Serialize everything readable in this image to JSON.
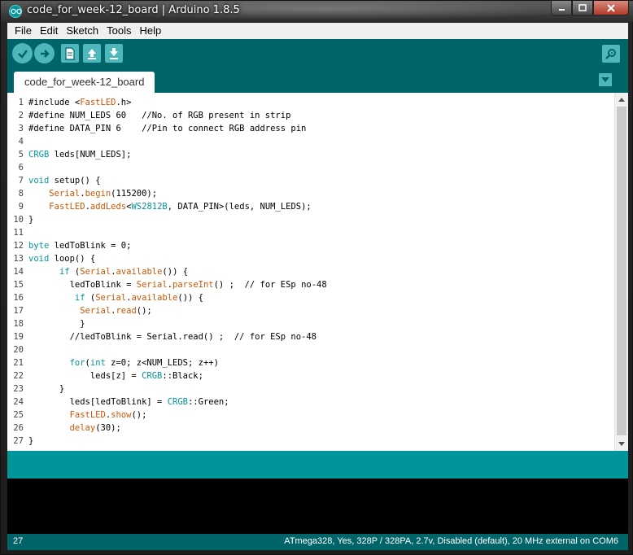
{
  "window": {
    "title": "code_for_week-12_board | Arduino 1.8.5"
  },
  "menu": [
    "File",
    "Edit",
    "Sketch",
    "Tools",
    "Help"
  ],
  "toolbar": {
    "buttons": [
      "verify-icon",
      "upload-icon",
      "new-icon",
      "open-icon",
      "save-icon"
    ],
    "serial_monitor": "serial-monitor-icon"
  },
  "tabs": [
    "code_for_week-12_board"
  ],
  "code_lines": [
    {
      "n": "1",
      "t": "#include <FastLED.h>"
    },
    {
      "n": "2",
      "t": "#define NUM_LEDS 60   //No. of RGB present in strip"
    },
    {
      "n": "3",
      "t": "#define DATA_PIN 6    //Pin to connect RGB address pin"
    },
    {
      "n": "4",
      "t": ""
    },
    {
      "n": "5",
      "t": "CRGB leds[NUM_LEDS];"
    },
    {
      "n": "6",
      "t": ""
    },
    {
      "n": "7",
      "t": "void setup() {"
    },
    {
      "n": "8",
      "t": "    Serial.begin(115200);"
    },
    {
      "n": "9",
      "t": "    FastLED.addLeds<WS2812B, DATA_PIN>(leds, NUM_LEDS);"
    },
    {
      "n": "10",
      "t": "}"
    },
    {
      "n": "11",
      "t": ""
    },
    {
      "n": "12",
      "t": "byte ledToBlink = 0;"
    },
    {
      "n": "13",
      "t": "void loop() {"
    },
    {
      "n": "14",
      "t": "      if (Serial.available()) {"
    },
    {
      "n": "15",
      "t": "        ledToBlink = Serial.parseInt() ;  // for ESp no-48"
    },
    {
      "n": "16",
      "t": "         if (Serial.available()) {"
    },
    {
      "n": "17",
      "t": "          Serial.read();"
    },
    {
      "n": "18",
      "t": "          }"
    },
    {
      "n": "19",
      "t": "        //ledToBlink = Serial.read() ;  // for ESp no-48"
    },
    {
      "n": "20",
      "t": ""
    },
    {
      "n": "21",
      "t": "        for(int z=0; z<NUM_LEDS; z++)"
    },
    {
      "n": "22",
      "t": "            leds[z] = CRGB::Black;"
    },
    {
      "n": "23",
      "t": "      }"
    },
    {
      "n": "24",
      "t": "        leds[ledToBlink] = CRGB::Green;"
    },
    {
      "n": "25",
      "t": "        FastLED.show();"
    },
    {
      "n": "26",
      "t": "        delay(30);"
    },
    {
      "n": "27",
      "t": "}"
    }
  ],
  "footer": {
    "line": "27",
    "board": "ATmega328, Yes, 328P / 328PA, 2.7v, Disabled (default), 20 MHz external on COM6"
  },
  "colors": {
    "toolbar": "#006468",
    "status": "#009599",
    "keyword": "#00979c",
    "function": "#d35400"
  }
}
